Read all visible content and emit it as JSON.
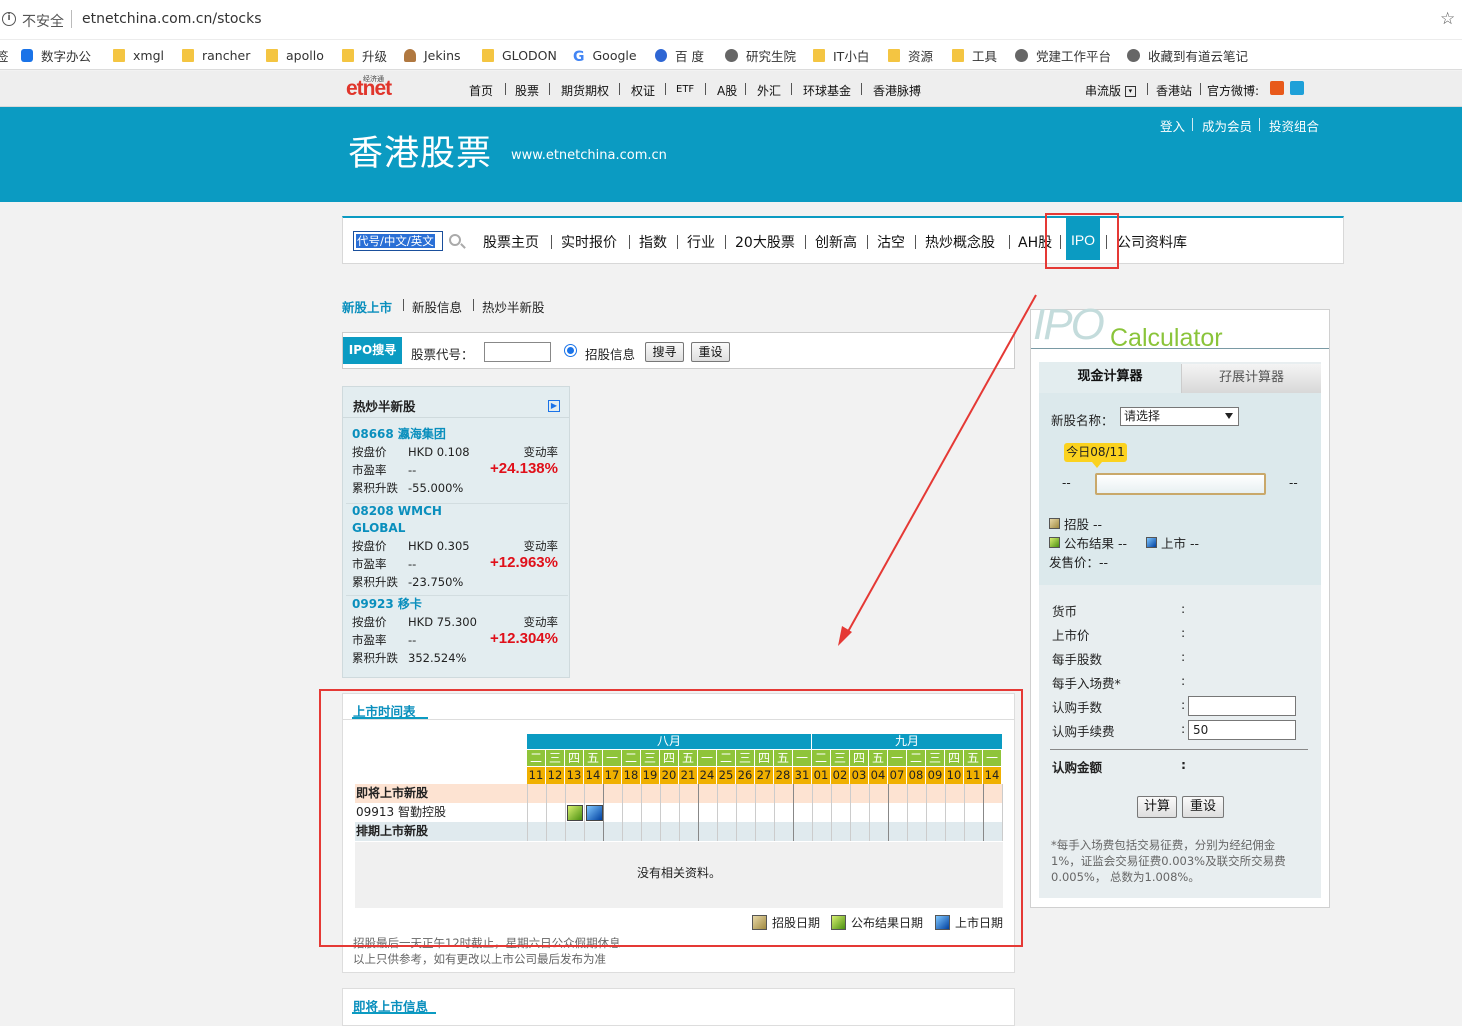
{
  "browser": {
    "info_icon": "info-icon",
    "security_label": "不安全",
    "url": "etnetchina.com.cn/stocks",
    "bookmarks": [
      "签",
      "数字办公",
      "xmgl",
      "rancher",
      "apollo",
      "升级",
      "Jekins",
      "GLODON",
      "Google",
      "百 度",
      "研究生院",
      "IT小白",
      "资源",
      "工具",
      "党建工作平台",
      "收藏到有道云笔记"
    ]
  },
  "topnav": {
    "logo_small": "经济通",
    "logo": "etnet",
    "items": [
      "首页",
      "股票",
      "期货期权",
      "权证",
      "ETF",
      "A股",
      "外汇",
      "环球基金",
      "香港脉搏"
    ],
    "right": [
      "串流版",
      "香港站",
      "官方微博:"
    ]
  },
  "banner": {
    "title": "香港股票",
    "site": "www.etnetchina.com.cn",
    "links": [
      "登入",
      "成为会员",
      "投资组合"
    ]
  },
  "search_nav": {
    "placeholder": "代号/中文/英文",
    "items": [
      "股票主页",
      "实时报价",
      "指数",
      "行业",
      "20大股票",
      "创新高",
      "沽空",
      "热炒概念股",
      "AH股",
      "IPO",
      "公司资料库"
    ]
  },
  "subnav": [
    "新股上市",
    "新股信息",
    "热炒半新股"
  ],
  "ipo_search": {
    "label": "IPO搜寻",
    "code_label": "股票代号：",
    "radio_label": "招股信息",
    "search_btn": "搜寻",
    "reset_btn": "重设"
  },
  "hot_stocks": {
    "title": "热炒半新股",
    "labels": {
      "price": "按盘价",
      "pe": "市盈率",
      "cum": "累积升跌",
      "change": "变动率"
    },
    "items": [
      {
        "name": "08668 瀛海集团",
        "price": "HKD 0.108",
        "pe": "--",
        "cum": "-55.000%",
        "change": "+24.138%"
      },
      {
        "name": "08208 WMCH GLOBAL",
        "price": "HKD 0.305",
        "pe": "--",
        "cum": "-23.750%",
        "change": "+12.963%"
      },
      {
        "name": "09923 移卡",
        "price": "HKD 75.300",
        "pe": "--",
        "cum": "352.524%",
        "change": "+12.304%"
      }
    ]
  },
  "schedule": {
    "title": "上市时间表",
    "months": [
      "八月",
      "九月"
    ],
    "weekdays": [
      "二",
      "三",
      "四",
      "五",
      "一",
      "二",
      "三",
      "四",
      "五",
      "一",
      "二",
      "三",
      "四",
      "五",
      "一",
      "二",
      "三",
      "四",
      "五",
      "一",
      "二",
      "三",
      "四",
      "五",
      "一"
    ],
    "dates": [
      "11",
      "12",
      "13",
      "14",
      "17",
      "18",
      "19",
      "20",
      "21",
      "24",
      "25",
      "26",
      "27",
      "28",
      "31",
      "01",
      "02",
      "03",
      "04",
      "07",
      "08",
      "09",
      "10",
      "11",
      "14"
    ],
    "upcoming_label": "即将上市新股",
    "row_stock": "09913 智勤控股",
    "scheduled_label": "排期上市新股",
    "no_data": "没有相关资料。",
    "legend": [
      "招股日期",
      "公布结果日期",
      "上市日期"
    ],
    "note1": "招股最后一天正午12时截止，星期六日公众假期休息",
    "note2": "以上只供参考，如有更改以上市公司最后发布为准"
  },
  "upcoming_info_title": "即将上市信息",
  "calculator": {
    "logo_ipo": "IPO",
    "logo_calc": "Calculator",
    "tabs": [
      "现金计算器",
      "孖展计算器"
    ],
    "name_label": "新股名称：",
    "select_value": "请选择",
    "today": "今日08/11",
    "tl_left": "--",
    "tl_right": "--",
    "legend_sub": "招股 --",
    "legend_result": "公布结果 --",
    "legend_list": "上市 --",
    "issue_price": "发售价：--",
    "fields": [
      "货币",
      "上市价",
      "每手股数",
      "每手入场费*",
      "认购手数",
      "认购手续费"
    ],
    "fee_value": "50",
    "total_label": "认购金额",
    "calc_btn": "计算",
    "reset_btn": "重设",
    "note": "*每手入场费包括交易征费，分别为经纪佣金1%，证监会交易征费0.003%及联交所交易费0.005%， 总数为1.008%。"
  }
}
